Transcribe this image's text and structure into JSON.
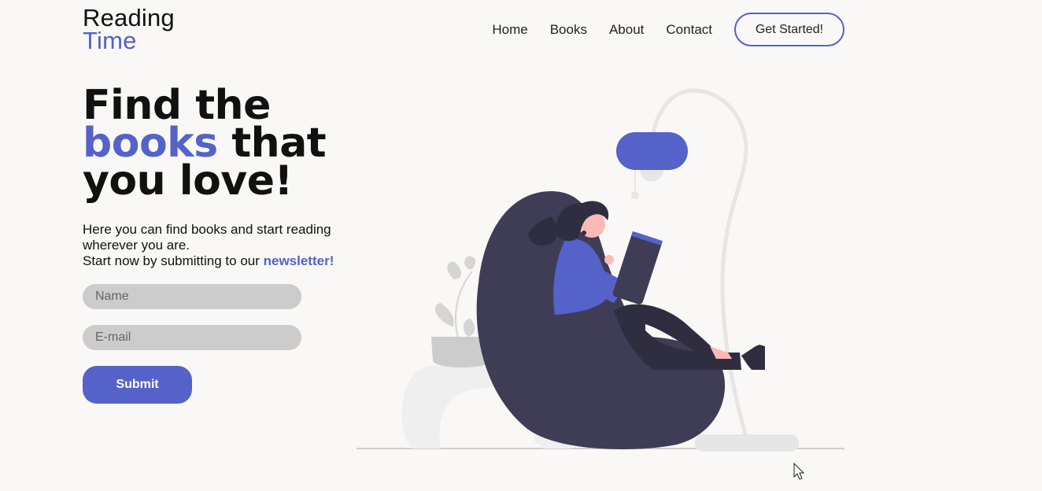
{
  "logo": {
    "line1": "Reading",
    "line2": "Time"
  },
  "nav": {
    "items": [
      "Home",
      "Books",
      "About",
      "Contact"
    ],
    "cta_label": "Get Started!"
  },
  "hero": {
    "title_line1": "Find the",
    "title_accent": "books",
    "title_line2_rest": " that",
    "title_line3": "you love!",
    "desc_line1": "Here you can find books and start reading",
    "desc_line2": "wherever you are.",
    "desc_line3_prefix": "Start now by submitting to our ",
    "desc_link": "newsletter!"
  },
  "form": {
    "name_placeholder": "Name",
    "email_placeholder": "E-mail",
    "submit_label": "Submit"
  },
  "colors": {
    "accent": "#5462c9",
    "background": "#f9f8f6",
    "field": "#cccccc",
    "chair": "#3f3d56"
  },
  "illustration": {
    "icon": "woman-reading-in-beanbag-illustration"
  }
}
